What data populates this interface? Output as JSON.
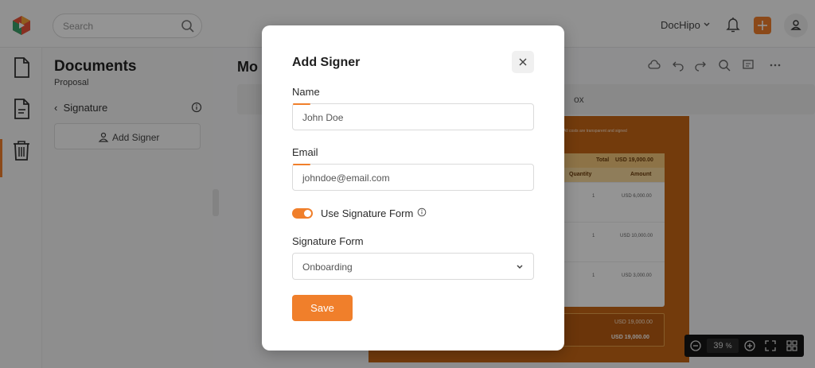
{
  "topbar": {
    "search_placeholder": "Search",
    "brand": "DocHipo"
  },
  "sidebar_panel": {
    "title": "Documents",
    "subtitle": "Proposal",
    "back_label": "Signature",
    "add_signer_label": "Add Signer"
  },
  "document": {
    "title": "Mo",
    "tab_fragment": "ox",
    "note_fragment": "s. All costs are transparent and signed",
    "table": {
      "total_label": "Total",
      "total_value": "USD 19,000.00",
      "col_quantity": "Quantity",
      "col_amount": "Amount",
      "rows": [
        {
          "qty": "1",
          "amount": "USD 6,000.00"
        },
        {
          "qty": "1",
          "amount": "USD 10,000.00"
        },
        {
          "qty": "1",
          "amount": "USD 3,000.00"
        }
      ],
      "subtotal": "USD 19,000.00",
      "grand_total": "USD 19,000.00"
    },
    "zoom_value": "39",
    "zoom_unit": "%"
  },
  "modal": {
    "title": "Add Signer",
    "name_label": "Name",
    "name_placeholder": "John Doe",
    "email_label": "Email",
    "email_placeholder": "johndoe@email.com",
    "toggle_label": "Use Signature Form",
    "toggle_on": true,
    "signature_form_label": "Signature Form",
    "signature_form_value": "Onboarding",
    "save_label": "Save"
  },
  "colors": {
    "accent": "#f07f2b",
    "paper": "#c66616",
    "overlay": "rgba(0,0,0,0.42)"
  }
}
